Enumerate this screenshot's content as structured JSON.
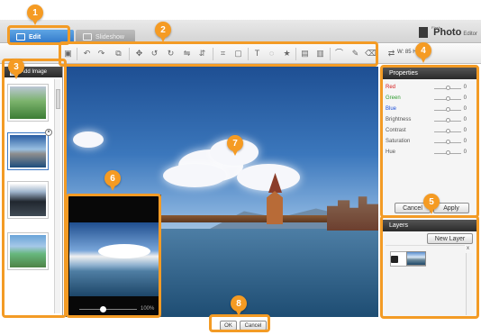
{
  "tabs": {
    "edit": "Edit",
    "slideshow": "Slideshow"
  },
  "brand": {
    "small": "Flash",
    "name": "Photo",
    "suffix": "Editor"
  },
  "toolbar": {
    "size_readout": "W: 85   H: 65",
    "icons": [
      "image-icon",
      "undo-icon",
      "redo-icon",
      "copy-icon",
      "move-icon",
      "rotate-left-icon",
      "rotate-right-icon",
      "flip-horizontal-icon",
      "flip-vertical-icon",
      "crop-icon",
      "resize-icon",
      "text-icon",
      "speech-bubble-icon",
      "star-icon",
      "frame-icon",
      "picture-icon",
      "brush-icon",
      "pencil-icon",
      "eraser-icon",
      "aspect-icon"
    ]
  },
  "left_panel": {
    "add_image": "Add Image"
  },
  "preview": {
    "zoom": "100%"
  },
  "properties": {
    "title": "Properties",
    "rows": [
      {
        "label": "Red",
        "value": "0",
        "color": "#d51a1a"
      },
      {
        "label": "Green",
        "value": "0",
        "color": "#2e9b2e"
      },
      {
        "label": "Blue",
        "value": "0",
        "color": "#1d50d8"
      },
      {
        "label": "Brightness",
        "value": "0",
        "color": "#555555"
      },
      {
        "label": "Contrast",
        "value": "0",
        "color": "#555555"
      },
      {
        "label": "Saturation",
        "value": "0",
        "color": "#555555"
      },
      {
        "label": "Hue",
        "value": "0",
        "color": "#555555"
      }
    ],
    "cancel": "Cancel",
    "apply": "Apply"
  },
  "layers": {
    "title": "Layers",
    "new_layer": "New Layer",
    "close": "x"
  },
  "bottom": {
    "ok": "OK",
    "cancel": "Cancel"
  },
  "callouts": [
    "1",
    "2",
    "3",
    "4",
    "5",
    "6",
    "7",
    "8"
  ],
  "colors": {
    "callout": "#f59b23",
    "tab_edit": "#2f76c8"
  }
}
